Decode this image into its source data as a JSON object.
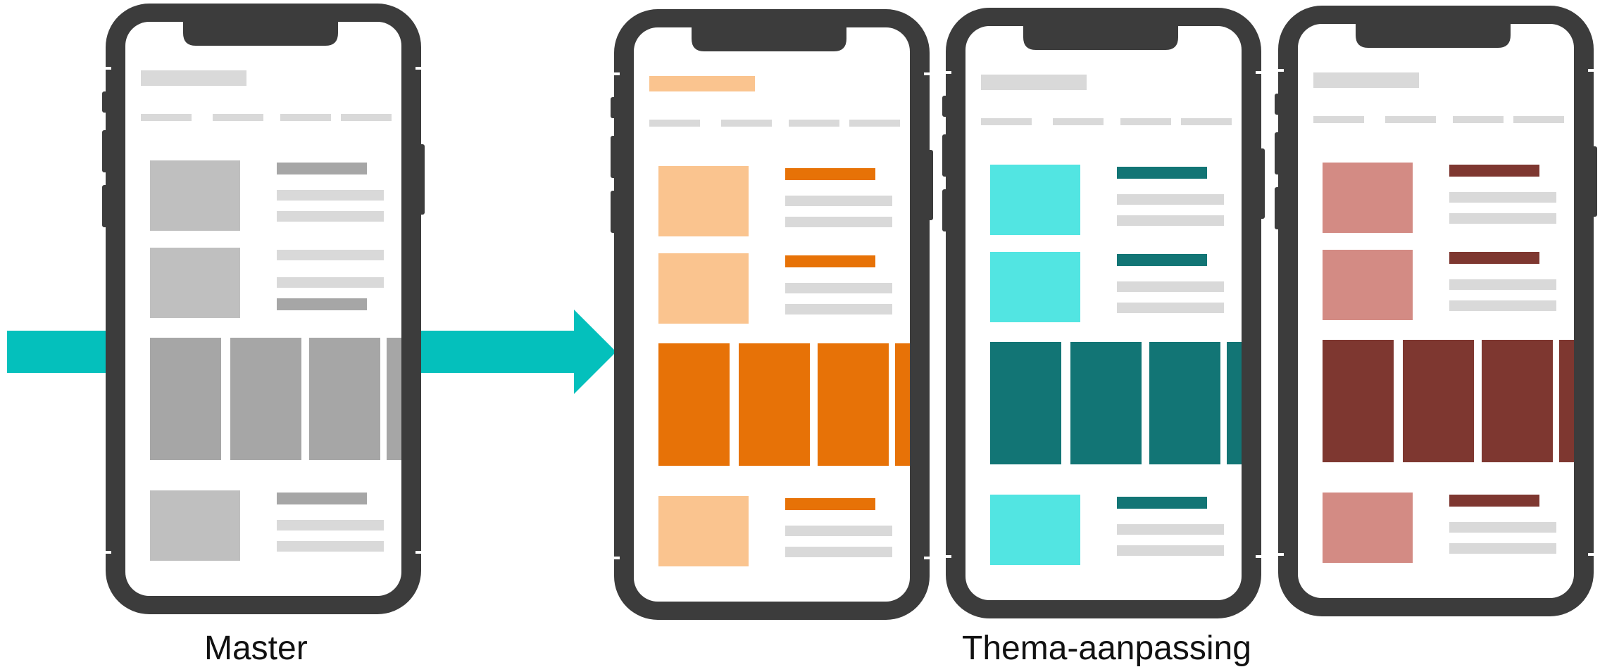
{
  "captions": {
    "master": "Master",
    "theme": "Thema-aanpassing"
  },
  "colors": {
    "arrow": "#04C0BC",
    "phone_frame": "#3C3C3C",
    "screen": "#FFFFFF",
    "placeholder_line": "#D9D9D9"
  },
  "phones": [
    {
      "name": "master",
      "light": "#BFBFBF",
      "dark": "#A6A6A6",
      "header": "#D9D9D9"
    },
    {
      "name": "orange-theme",
      "light": "#FAC48F",
      "dark": "#E77207",
      "header": "#FAC48F"
    },
    {
      "name": "teal-theme",
      "light": "#52E5E2",
      "dark": "#127575",
      "header": "#D9D9D9"
    },
    {
      "name": "red-theme",
      "light": "#D38B84",
      "dark": "#7E3730",
      "header": "#D9D9D9"
    }
  ]
}
